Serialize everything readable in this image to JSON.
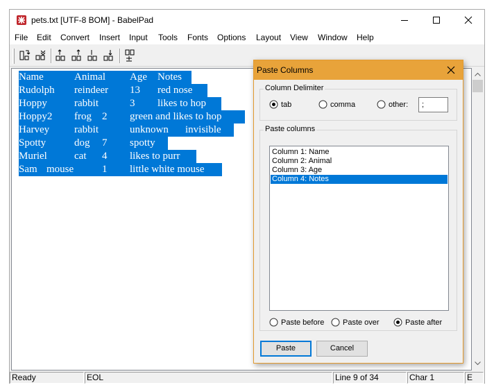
{
  "window": {
    "title": "pets.txt [UTF-8 BOM] - BabelPad",
    "icons": {
      "app": "babelpad-logo-icon",
      "minimize": "minimize-icon",
      "maximize": "maximize-icon",
      "close": "close-icon"
    }
  },
  "menu": [
    "File",
    "Edit",
    "Convert",
    "Insert",
    "Input",
    "Tools",
    "Fonts",
    "Options",
    "Layout",
    "View",
    "Window",
    "Help"
  ],
  "toolbar": {
    "buttons": [
      "insert-column-before-icon",
      "insert-column-after-icon",
      "move-row-up-icon",
      "move-row-up-2-icon",
      "move-row-down-icon",
      "move-row-down-2-icon",
      "paste-columns-icon"
    ]
  },
  "editor": {
    "lines": [
      [
        "Name",
        "Animal",
        "Age",
        "Notes"
      ],
      [
        "Rudolph",
        "reindeer",
        "13",
        "red nose"
      ],
      [
        "Hoppy",
        "rabbit",
        "3",
        "likes to hop"
      ],
      [
        "Hoppy2",
        "frog",
        "2",
        "green and likes to hop"
      ],
      [
        "Harvey",
        "rabbit",
        "unknown",
        "invisible"
      ],
      [
        "Spotty",
        "dog",
        "7",
        "spotty"
      ],
      [
        "Muriel",
        "cat",
        "4",
        "likes to purr"
      ],
      [
        "Sam",
        "mouse",
        "1",
        "little white mouse"
      ]
    ],
    "selection_color": "#0078d7"
  },
  "status": {
    "state": "Ready",
    "eol": "EOL",
    "line": "Line 9 of 34",
    "char": "Char 1",
    "extra": "E"
  },
  "dialog": {
    "title": "Paste Columns",
    "accent_color": "#e8a33a",
    "delimiter": {
      "label": "Column Delimiter",
      "options": [
        "tab",
        "comma",
        "other:"
      ],
      "selected": "tab",
      "other_value": ";"
    },
    "columns": {
      "label": "Paste columns",
      "items": [
        "Column 1: Name",
        "Column 2: Animal",
        "Column 3: Age",
        "Column 4: Notes"
      ],
      "selected": "Column 4: Notes"
    },
    "position": {
      "options": [
        "Paste before",
        "Paste over",
        "Paste after"
      ],
      "selected": "Paste after"
    },
    "buttons": {
      "paste": "Paste",
      "cancel": "Cancel"
    }
  }
}
